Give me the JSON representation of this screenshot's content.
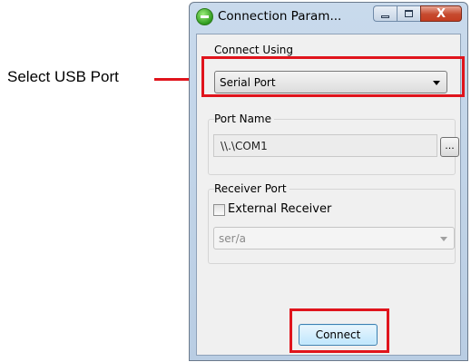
{
  "annotations": {
    "select_usb_port": "Select USB Port"
  },
  "window": {
    "title": "Connection Param...",
    "controls": {
      "close_glyph": "X"
    }
  },
  "connect_using": {
    "label": "Connect Using",
    "selected": "Serial Port"
  },
  "port_name": {
    "label": "Port Name",
    "value": "\\\\.\\COM1",
    "browse_label": "..."
  },
  "receiver_port": {
    "label": "Receiver Port",
    "external_receiver_label": "External Receiver",
    "external_receiver_checked": false,
    "selected": "ser/a"
  },
  "connect_button": {
    "label": "Connect"
  },
  "colors": {
    "highlight": "#e0141c",
    "window_frame": "#b9cde3",
    "client_bg": "#f0f0f0"
  }
}
